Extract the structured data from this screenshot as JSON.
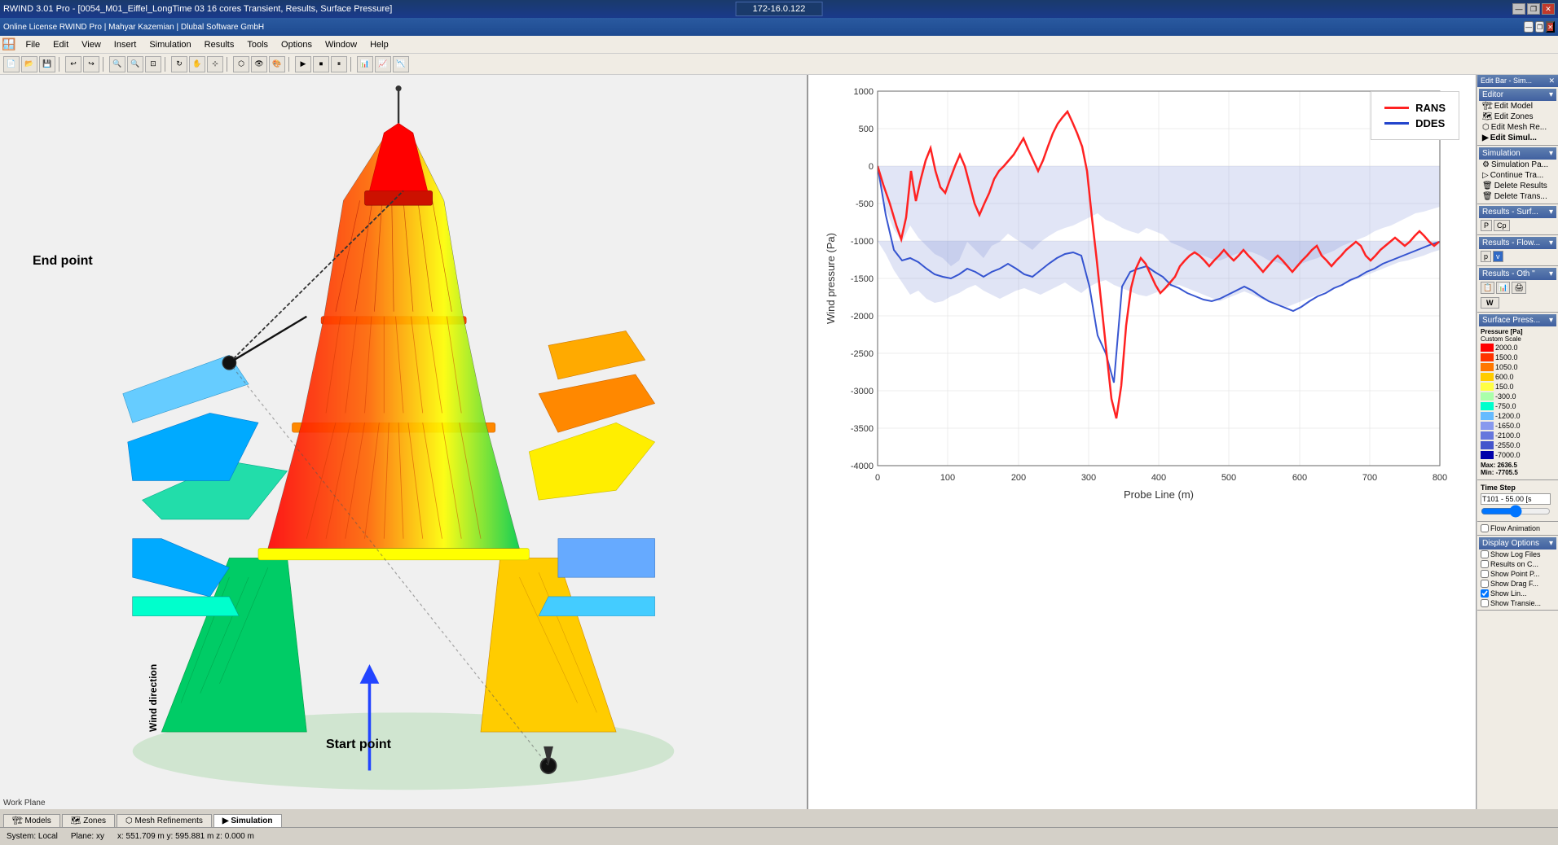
{
  "titleBar": {
    "title": "RWIND 3.01 Pro - [0054_M01_Eiffel_LongTime 03 16 cores Transient, Results, Surface Pressure]",
    "ipAddress": "172-16.0.122",
    "winControls": [
      "—",
      "❐",
      "✕"
    ]
  },
  "secondaryBar": {
    "title": "Online License RWIND Pro | Mahyar Kazemian | Dlubal Software GmbH",
    "winControls": [
      "—",
      "❐",
      "✕"
    ]
  },
  "menuBar": {
    "items": [
      "File",
      "Edit",
      "View",
      "Insert",
      "Simulation",
      "Results",
      "Tools",
      "Options",
      "Window",
      "Help"
    ]
  },
  "statusBar": {
    "system": "System: Local",
    "plane": "Plane: xy",
    "coords": "x: 551.709 m  y: 595.881 m  z: 0.000 m"
  },
  "tabs": [
    {
      "label": "Models",
      "active": false
    },
    {
      "label": "Zones",
      "active": false
    },
    {
      "label": "Mesh Refinements",
      "active": false
    },
    {
      "label": "Simulation",
      "active": true
    }
  ],
  "rightSidebar": {
    "editBarTitle": "Edit Bar - Sim...",
    "editorTitle": "Editor",
    "editorItems": [
      "Edit Model",
      "Edit Zones",
      "Edit Mesh Re...",
      "Edit Simul..."
    ],
    "simulationTitle": "Simulation",
    "simulationItems": [
      "Simulation Pa...",
      "Continue Tra...",
      "Delete Results",
      "Delete Trans..."
    ],
    "resultsSurfTitle": "Results - Surf...",
    "resultsFlowTitle": "Results - Flow...",
    "resultsOthTitle": "Results - Oth \"",
    "surfacePressTitle": "Surface Press...",
    "pressureScale": {
      "unit": "Pressure [Pa]",
      "scaleType": "Custom Scale",
      "values": [
        {
          "color": "#ff0000",
          "label": "2000.0"
        },
        {
          "color": "#ff2200",
          "label": "1500.0"
        },
        {
          "color": "#ff5500",
          "label": "1050.0"
        },
        {
          "color": "#ffaa00",
          "label": "600.0"
        },
        {
          "color": "#ffff00",
          "label": "150.0"
        },
        {
          "color": "#aaffaa",
          "label": "-300.0"
        },
        {
          "color": "#00ffaa",
          "label": "-750.0"
        },
        {
          "color": "#00aaff",
          "label": "-1200.0"
        },
        {
          "color": "#7799ff",
          "label": "-1650.0"
        },
        {
          "color": "#5566ee",
          "label": "-2100.0"
        },
        {
          "color": "#3344cc",
          "label": "-2550.0"
        },
        {
          "color": "#0000aa",
          "label": "-7000.0"
        }
      ],
      "max": "Max: 2636.5",
      "min": "Min: -7705.5"
    },
    "timeStep": {
      "label": "Time Step",
      "value": "T101 - 55.00 [s"
    },
    "displayOptions": {
      "title": "Display Options",
      "flowAnimation": "Flow Animation",
      "options": [
        {
          "label": "Show Log Files",
          "checked": false
        },
        {
          "label": "Results on C...",
          "checked": false
        },
        {
          "label": "Show Point P...",
          "checked": false
        },
        {
          "label": "Show Drag F...",
          "checked": false
        },
        {
          "label": "Show Lin...",
          "checked": true
        },
        {
          "label": "Show Transie...",
          "checked": false
        }
      ]
    }
  },
  "chart": {
    "title": "",
    "xAxisLabel": "Probe Line (m)",
    "yAxisLabel": "Wind pressure (Pa)",
    "xMin": 0,
    "xMax": 800,
    "yMin": -4000,
    "yMax": 1000,
    "xTicks": [
      0,
      100,
      200,
      300,
      400,
      500,
      600,
      700,
      800
    ],
    "yTicks": [
      1000,
      500,
      0,
      -500,
      -1000,
      -1500,
      -2000,
      -2500,
      -3000,
      -3500,
      -4000
    ],
    "legend": [
      {
        "label": "RANS",
        "color": "#ff2222"
      },
      {
        "label": "DDES",
        "color": "#2244cc"
      }
    ]
  },
  "annotations": {
    "endPoint": "End point",
    "startPoint": "Start point",
    "windDirection": "Wind direction"
  }
}
